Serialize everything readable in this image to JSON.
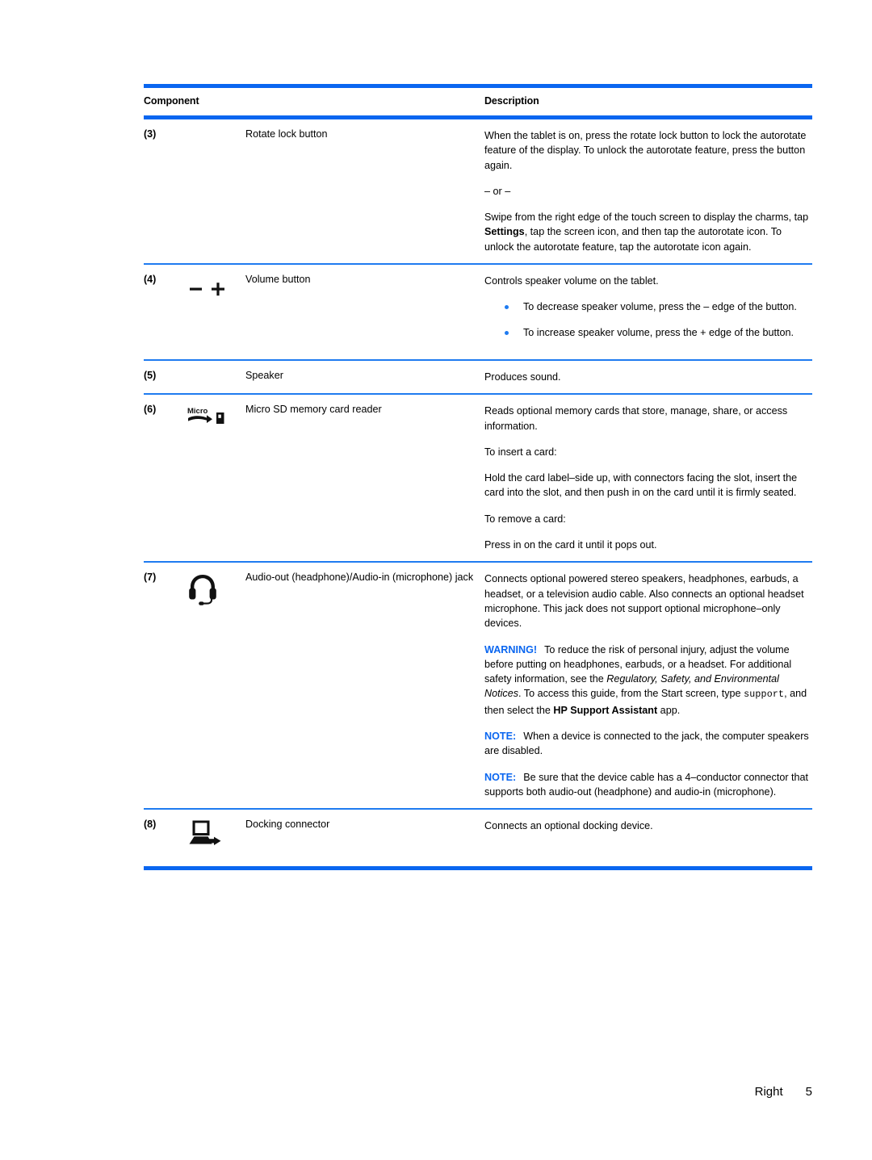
{
  "table": {
    "headers": {
      "component": "Component",
      "description": "Description"
    },
    "rows": [
      {
        "number": "(3)",
        "icon": "none",
        "label": "Rotate lock button",
        "description": {
          "para1": "When the tablet is on, press the rotate lock button to lock the autorotate feature of the display. To unlock the autorotate feature, press the button again.",
          "or_separator": "– or –",
          "para2_pre": "Swipe from the right edge of the touch screen to display the charms, tap ",
          "para2_bold": "Settings",
          "para2_post": ", tap the screen icon, and then tap the autorotate icon. To unlock the autorotate feature, tap the autorotate icon again."
        }
      },
      {
        "number": "(4)",
        "icon": "volume-minus-plus-icon",
        "label": "Volume button",
        "description": {
          "para1": "Controls speaker volume on the tablet.",
          "bullets": [
            "To decrease speaker volume, press the – edge of the button.",
            "To increase speaker volume, press the + edge of the button."
          ]
        }
      },
      {
        "number": "(5)",
        "icon": "none",
        "label": "Speaker",
        "description": {
          "para1": "Produces sound."
        }
      },
      {
        "number": "(6)",
        "icon": "micro-sd-card-icon",
        "label": "Micro SD memory card reader",
        "description": {
          "para1": "Reads optional memory cards that store, manage, share, or access information.",
          "para2": "To insert a card:",
          "para3": "Hold the card label–side up, with connectors facing the slot, insert the card into the slot, and then push in on the card until it is firmly seated.",
          "para4": "To remove a card:",
          "para5": "Press in on the card it until it pops out."
        }
      },
      {
        "number": "(7)",
        "icon": "headset-icon",
        "label": "Audio-out (headphone)/Audio-in (microphone) jack",
        "description": {
          "para1": "Connects optional powered stereo speakers, headphones, earbuds, a headset, or a television audio cable. Also connects an optional headset microphone. This jack does not support optional microphone–only devices.",
          "warning_label": "WARNING!",
          "warning_pre": "To reduce the risk of personal injury, adjust the volume before putting on headphones, earbuds, or a headset. For additional safety information, see the ",
          "warning_italic": "Regulatory, Safety, and Environmental Notices",
          "warning_mid": ". To access this guide, from the Start screen, type ",
          "warning_mono": "support",
          "warning_mid2": ", and then select the ",
          "warning_bold": "HP Support Assistant",
          "warning_post": " app.",
          "note1_label": "NOTE:",
          "note1_text": "When a device is connected to the jack, the computer speakers are disabled.",
          "note2_label": "NOTE:",
          "note2_text": "Be sure that the device cable has a 4–conductor connector that supports both audio-out (headphone) and audio-in (microphone)."
        }
      },
      {
        "number": "(8)",
        "icon": "docking-connector-icon",
        "label": "Docking connector",
        "description": {
          "para1": "Connects an optional docking device."
        }
      }
    ]
  },
  "footer": {
    "section": "Right",
    "page_number": "5"
  },
  "colors": {
    "accent_blue": "#0a66f0",
    "rule_blue": "#1f7bf0",
    "text": "#000000"
  }
}
